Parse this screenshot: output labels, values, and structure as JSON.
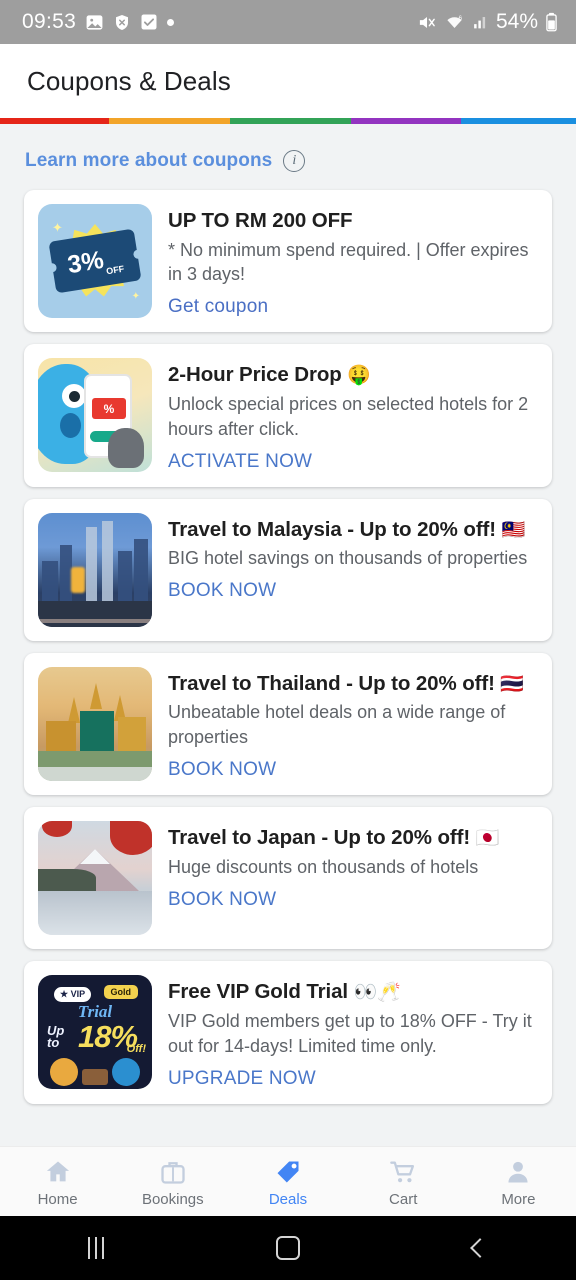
{
  "status_bar": {
    "time": "09:53",
    "battery_percent": "54%",
    "left_icons": [
      "image-icon",
      "shield-x-icon",
      "checkbox-icon",
      "dot-indicator"
    ],
    "right_icons": [
      "volume-mute-icon",
      "wifi-6-icon",
      "cellular-signal-icon",
      "battery-icon"
    ],
    "background": "#9e9e9e"
  },
  "header": {
    "title": "Coupons & Deals",
    "stripe_colors": [
      "#e52518",
      "#f2a429",
      "#32a357",
      "#9334c0",
      "#1a8fe0"
    ]
  },
  "learn_more": {
    "label": "Learn more about coupons",
    "icon": "info-icon",
    "color": "#5b8fdd"
  },
  "cards": [
    {
      "title": "UP TO RM 200 OFF",
      "emoji": "",
      "description": "* No minimum spend required. | Offer expires in 3 days!",
      "cta": "Get coupon",
      "cta_style": "sentence",
      "thumb": "coupon-3-percent-off-image",
      "thumb_text": {
        "percent": "3%",
        "off": "OFF"
      }
    },
    {
      "title": "2-Hour Price Drop",
      "emoji": "🤑",
      "description": "Unlock special prices on selected hotels for 2 hours after click.",
      "cta": "ACTIVATE NOW",
      "cta_style": "caps",
      "thumb": "price-drop-character-phone-image",
      "thumb_text": {
        "percent": "%"
      }
    },
    {
      "title": "Travel to Malaysia - Up to 20% off!",
      "emoji": "🇲🇾",
      "description": "BIG hotel savings on thousands of properties",
      "cta": "BOOK NOW",
      "cta_style": "caps",
      "thumb": "kuala-lumpur-skyline-image"
    },
    {
      "title": "Travel to Thailand - Up to 20% off!",
      "emoji": "🇹🇭",
      "description": "Unbeatable hotel deals on a wide range of properties",
      "cta": "BOOK NOW",
      "cta_style": "caps",
      "thumb": "thailand-grand-palace-image"
    },
    {
      "title": "Travel to Japan - Up to 20% off!",
      "emoji": "🇯🇵",
      "description": "Huge discounts on thousands of hotels",
      "cta": "BOOK NOW",
      "cta_style": "caps",
      "thumb": "mount-fuji-image"
    },
    {
      "title": "Free VIP Gold Trial",
      "emoji": "👀🥂",
      "description": "VIP Gold members get up to 18% OFF - Try it out for 14-days! Limited time only.",
      "cta": "UPGRADE NOW",
      "cta_style": "caps",
      "thumb": "vip-gold-trial-image",
      "thumb_text": {
        "vip": "★ VIP",
        "gold": "Gold",
        "trial": "Trial",
        "upto": "Up\nto",
        "pct": "18%",
        "off": "Off!"
      }
    }
  ],
  "bottom_nav": {
    "active": "Deals",
    "active_color": "#4285f4",
    "items": [
      {
        "label": "Home",
        "icon": "home-icon"
      },
      {
        "label": "Bookings",
        "icon": "suitcase-icon"
      },
      {
        "label": "Deals",
        "icon": "tag-icon"
      },
      {
        "label": "Cart",
        "icon": "shopping-cart-icon"
      },
      {
        "label": "More",
        "icon": "person-icon"
      }
    ]
  },
  "android_nav": {
    "items": [
      {
        "name": "recents-button",
        "icon": "recents-icon"
      },
      {
        "name": "home-button",
        "icon": "home-square-icon"
      },
      {
        "name": "back-button",
        "icon": "back-chevron-icon"
      }
    ]
  }
}
